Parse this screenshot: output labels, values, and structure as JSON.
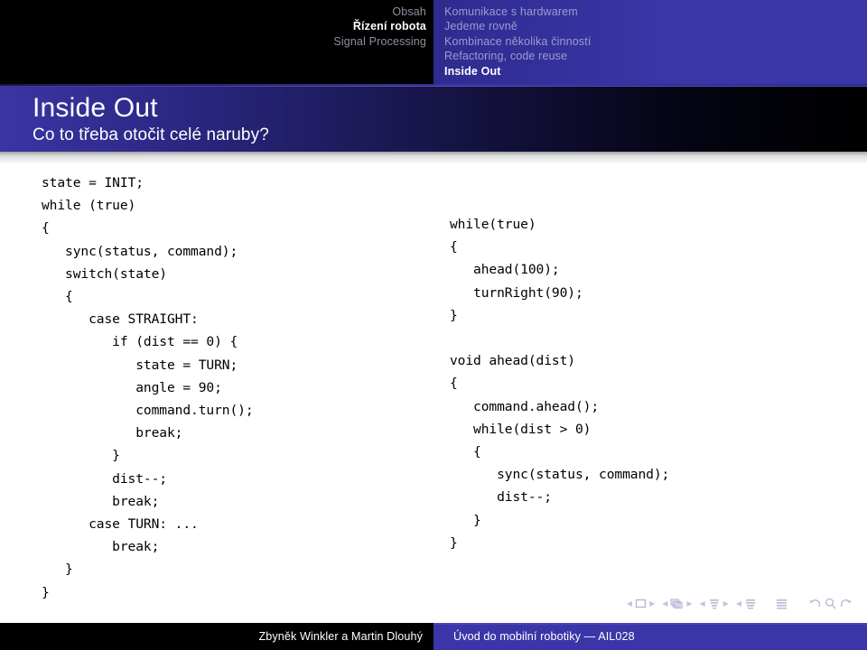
{
  "header": {
    "left_nav": [
      {
        "label": "Obsah",
        "current": false
      },
      {
        "label": "Řízení robota",
        "current": true
      },
      {
        "label": "Signal Processing",
        "current": false
      }
    ],
    "right_nav": [
      {
        "label": "Komunikace s hardwarem",
        "current": false
      },
      {
        "label": "Jedeme rovně",
        "current": false
      },
      {
        "label": "Kombinace několika činností",
        "current": false
      },
      {
        "label": "Refactoring, code reuse",
        "current": false
      },
      {
        "label": "Inside Out",
        "current": true
      }
    ]
  },
  "title_bar": {
    "title": "Inside Out",
    "subtitle": "Co to třeba otočit celé naruby?"
  },
  "content": {
    "left_code": "state = INIT;\nwhile (true)\n{\n   sync(status, command);\n   switch(state)\n   {\n      case STRAIGHT:\n         if (dist == 0) {\n            state = TURN;\n            angle = 90;\n            command.turn();\n            break;\n         }\n         dist--;\n         break;\n      case TURN: ...\n         break;\n   }\n}",
    "right_code": "while(true)\n{\n   ahead(100);\n   turnRight(90);\n}\n\nvoid ahead(dist)\n{\n   command.ahead();\n   while(dist > 0)\n   {\n      sync(status, command);\n      dist--;\n   }\n}"
  },
  "nav_symbols": {
    "groups": [
      {
        "prev": "◀",
        "icon": "slide-icon",
        "next": "▶"
      },
      {
        "prev": "◀",
        "icon": "frames-icon",
        "next": "▶"
      },
      {
        "prev": "◀",
        "icon": "subsection-icon",
        "next": "▶"
      },
      {
        "prev": "◀",
        "icon": "section-icon",
        "next": ""
      }
    ],
    "doc_icon": "document-icon",
    "back_icon": "back-icon",
    "search_icon": "search-icon",
    "forward_icon": "forward-icon"
  },
  "footer": {
    "authors": "Zbyněk Winkler a Martin Dlouhý",
    "course": "Úvod do mobilní robotiky — AIL028"
  },
  "colors": {
    "brand_blue": "#3a36a8",
    "dark": "#000000",
    "nav_inactive": "#9c9ccd",
    "nav_active": "#ffffff"
  }
}
